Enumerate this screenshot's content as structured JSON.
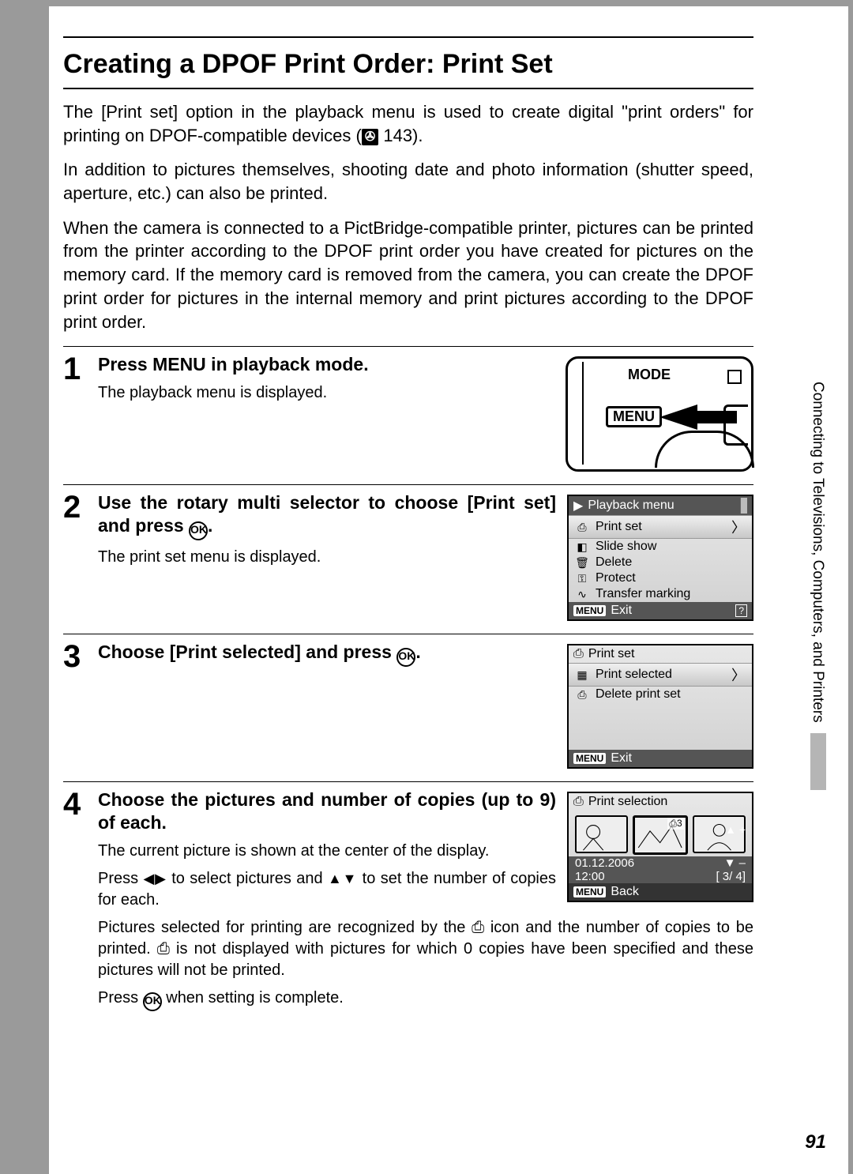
{
  "page": {
    "title": "Creating a DPOF Print Order: Print Set",
    "intro1a": "The [Print set] option in the playback menu is used to create digital \"print orders\" for printing on DPOF-compatible devices (",
    "intro1b": " 143).",
    "intro2": "In addition to pictures themselves, shooting date and photo information (shutter speed, aperture, etc.) can also be printed.",
    "intro3": "When the camera is connected to a PictBridge-compatible printer, pictures can be printed from the printer according to the DPOF print order you have created for pictures on the memory card. If the memory card is removed from the camera, you can create the DPOF print order for pictures in the internal memory and print pictures according to the DPOF print order.",
    "crossref_icon": "✇",
    "number": "91",
    "side_text": "Connecting to Televisions, Computers, and Printers"
  },
  "steps": {
    "s1": {
      "num": "1",
      "title_a": "Press ",
      "title_menu": "MENU",
      "title_b": " in playback mode.",
      "desc": "The playback menu is displayed.",
      "mode_label": "MODE",
      "menu_label": "MENU"
    },
    "s2": {
      "num": "2",
      "title_a": "Use the rotary multi selector to choose [Print set] and press ",
      "ok": "OK",
      "title_b": ".",
      "desc": "The print set menu is displayed.",
      "lcd": {
        "title": "Playback menu",
        "items": [
          "Print set",
          "Slide show",
          "Delete",
          "Protect",
          "Transfer marking"
        ],
        "foot": "Exit",
        "menu": "MENU"
      }
    },
    "s3": {
      "num": "3",
      "title_a": "Choose [Print selected] and press ",
      "ok": "OK",
      "title_b": ".",
      "lcd": {
        "title": "Print set",
        "items": [
          "Print selected",
          "Delete print set"
        ],
        "foot": "Exit",
        "menu": "MENU"
      }
    },
    "s4": {
      "num": "4",
      "title": "Choose the pictures and number of copies (up to 9) of each.",
      "desc1": "The current picture is shown at the center of the display.",
      "desc2a": "Press ",
      "desc2b": " to select pictures and ",
      "desc2c": " to set the number of copies for each.",
      "desc3": "Pictures selected for printing are recognized by the ⎙ icon and the number of copies to be printed. ⎙ is not displayed with pictures for which 0 copies have been specified and these pictures will not be printed.",
      "desc4a": "Press ",
      "ok": "OK",
      "desc4b": " when setting is complete.",
      "lcd": {
        "title": "Print selection",
        "date": "01.12.2006",
        "time": "12:00",
        "count": "[   3/   4]",
        "foot": "Back",
        "menu": "MENU",
        "badge": "⎙3",
        "plus": "▲ +",
        "minus": "▼ –"
      }
    }
  }
}
